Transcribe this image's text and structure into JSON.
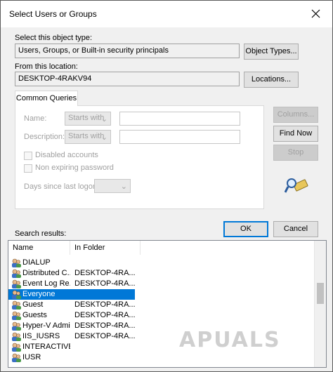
{
  "window": {
    "title": "Select Users or Groups"
  },
  "object_type": {
    "label": "Select this object type:",
    "value": "Users, Groups, or Built-in security principals",
    "button": "Object Types..."
  },
  "location": {
    "label": "From this location:",
    "value": "DESKTOP-4RAKV94",
    "button": "Locations..."
  },
  "queries": {
    "tab": "Common Queries",
    "name_label": "Name:",
    "name_mode": "Starts with",
    "description_label": "Description:",
    "description_mode": "Starts with",
    "disabled_accounts": "Disabled accounts",
    "non_expiring": "Non expiring password",
    "days_label": "Days since last logon:",
    "columns_button": "Columns...",
    "find_now_button": "Find Now",
    "stop_button": "Stop"
  },
  "actions": {
    "ok": "OK",
    "cancel": "Cancel"
  },
  "results": {
    "label": "Search results:",
    "columns": [
      "Name",
      "In Folder"
    ],
    "rows": [
      {
        "name": "DIALUP",
        "folder": ""
      },
      {
        "name": "Distributed C...",
        "folder": "DESKTOP-4RA..."
      },
      {
        "name": "Event Log Re...",
        "folder": "DESKTOP-4RA..."
      },
      {
        "name": "Everyone",
        "folder": ""
      },
      {
        "name": "Guest",
        "folder": "DESKTOP-4RA..."
      },
      {
        "name": "Guests",
        "folder": "DESKTOP-4RA..."
      },
      {
        "name": "Hyper-V Admi...",
        "folder": "DESKTOP-4RA..."
      },
      {
        "name": "IIS_IUSRS",
        "folder": "DESKTOP-4RA..."
      },
      {
        "name": "INTERACTIVE",
        "folder": ""
      },
      {
        "name": "IUSR",
        "folder": ""
      }
    ],
    "selected_index": 3
  },
  "watermark": "APUALS",
  "colors": {
    "accent": "#0078d7",
    "disabled_text": "#a0a0a0"
  }
}
